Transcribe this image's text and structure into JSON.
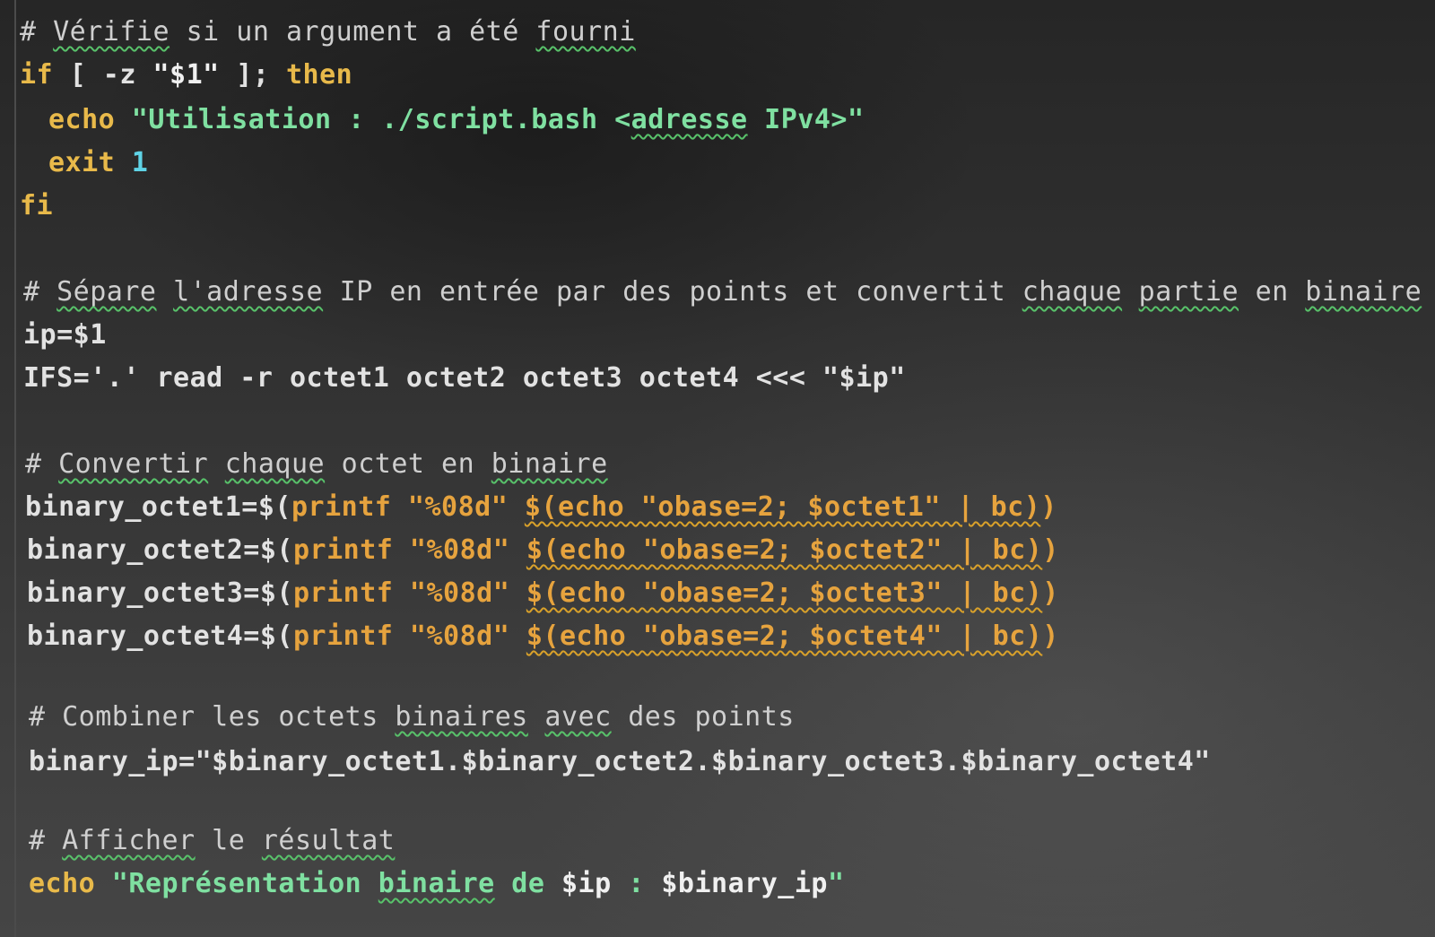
{
  "editor": {
    "lines": [
      {
        "t1": "# ",
        "t2": "Vérifie",
        "t3": " si un argument a été ",
        "t4": "fourni"
      },
      {
        "kw1": "if",
        "t1": " [ -z ",
        "str1": "\"$1\"",
        "t2": " ]; ",
        "kw2": "then"
      },
      {
        "kw1": "echo",
        "str1": " \"Utilisation : ./script.bash <",
        "sq": "adresse",
        "str2": " IPv4>\""
      },
      {
        "kw1": "exit",
        "num1": " 1"
      },
      {
        "kw1": "fi"
      },
      {
        "t1": "# ",
        "sq1": "Sépare",
        "t2": " ",
        "sq2": "l'adresse",
        "t3": " IP en entrée par des points et convertit ",
        "sq3": "chaque",
        "t4": " ",
        "sq4": "partie",
        "t5": " en ",
        "sq5": "binaire"
      },
      {
        "t1": "ip=$1"
      },
      {
        "t1": "IFS='.' read -r octet1 octet2 octet3 octet4 <<< \"$ip\""
      },
      {
        "t1": "# ",
        "sq1": "Convertir",
        "t2": " ",
        "sq2": "chaque",
        "t3": " octet en ",
        "sq3": "binaire"
      },
      {
        "a": "binary_octet1=$(",
        "b": "printf \"%08d\" ",
        "c": "$(echo \"obase=2; $octet1\" | bc)",
        "d": ")"
      },
      {
        "a": "binary_octet2=$(",
        "b": "printf \"%08d\" ",
        "c": "$(echo \"obase=2; $octet2\" | bc)",
        "d": ")"
      },
      {
        "a": "binary_octet3=$(",
        "b": "printf \"%08d\" ",
        "c": "$(echo \"obase=2; $octet3\" | bc)",
        "d": ")"
      },
      {
        "a": "binary_octet4=$(",
        "b": "printf \"%08d\" ",
        "c": "$(echo \"obase=2; $octet4\" | bc)",
        "d": ")"
      },
      {
        "t1": "# Combiner les octets ",
        "sq1": "binaires",
        "t2": " ",
        "sq2": "avec",
        "t3": " des points"
      },
      {
        "t1": "binary_ip=\"$binary_octet1.$binary_octet2.$binary_octet3.$binary_octet4\""
      },
      {
        "t1": "# ",
        "sq1": "Afficher",
        "t2": " le ",
        "sq2": "résultat"
      },
      {
        "kw1": "echo",
        "str1": " \"Représentation ",
        "sq": "binaire",
        "str2": " de ",
        "v1": "$ip",
        "str3": " : ",
        "v2": "$binary_ip",
        "str4": "\""
      }
    ]
  },
  "colors": {
    "background": "#2b2b2b",
    "keyword": "#e8b94a",
    "number": "#5fd3e6",
    "string": "#7fe0a1",
    "spell_squiggle": "#58c26a",
    "warning_squiggle": "#d9a12a"
  }
}
